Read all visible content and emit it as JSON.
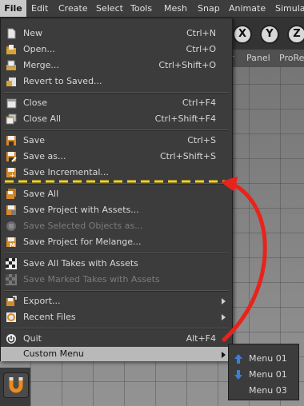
{
  "menubar": [
    "File",
    "Edit",
    "Create",
    "Select",
    "Tools",
    "Mesh",
    "Snap",
    "Animate",
    "Simulat"
  ],
  "viewbar": [
    "r",
    "Panel",
    "ProRe"
  ],
  "axes": [
    "X",
    "Y",
    "Z"
  ],
  "menu": {
    "new": {
      "label": "New",
      "shortcut": "Ctrl+N"
    },
    "open": {
      "label": "Open...",
      "shortcut": "Ctrl+O"
    },
    "merge": {
      "label": "Merge...",
      "shortcut": "Ctrl+Shift+O"
    },
    "revert": {
      "label": "Revert to Saved..."
    },
    "close": {
      "label": "Close",
      "shortcut": "Ctrl+F4"
    },
    "close_all": {
      "label": "Close All",
      "shortcut": "Ctrl+Shift+F4"
    },
    "save": {
      "label": "Save",
      "shortcut": "Ctrl+S"
    },
    "save_as": {
      "label": "Save as...",
      "shortcut": "Ctrl+Shift+S"
    },
    "save_incremental": {
      "label": "Save Incremental..."
    },
    "save_all": {
      "label": "Save All"
    },
    "save_project_assets": {
      "label": "Save Project with Assets..."
    },
    "save_selected": {
      "label": "Save Selected Objects as..."
    },
    "save_melange": {
      "label": "Save Project for Melange..."
    },
    "save_all_takes": {
      "label": "Save All Takes with Assets"
    },
    "save_marked_takes": {
      "label": "Save Marked Takes with Assets"
    },
    "export": {
      "label": "Export..."
    },
    "recent": {
      "label": "Recent Files"
    },
    "quit": {
      "label": "Quit",
      "shortcut": "Alt+F4"
    },
    "custom": {
      "label": "Custom Menu"
    }
  },
  "submenu": [
    "Menu 01",
    "Menu 01",
    "Menu 03"
  ],
  "colors": {
    "annotation_dash": "#f2d21e",
    "annotation_arrow": "#e8231c",
    "submenu_arrow": "#3d7fd6"
  }
}
